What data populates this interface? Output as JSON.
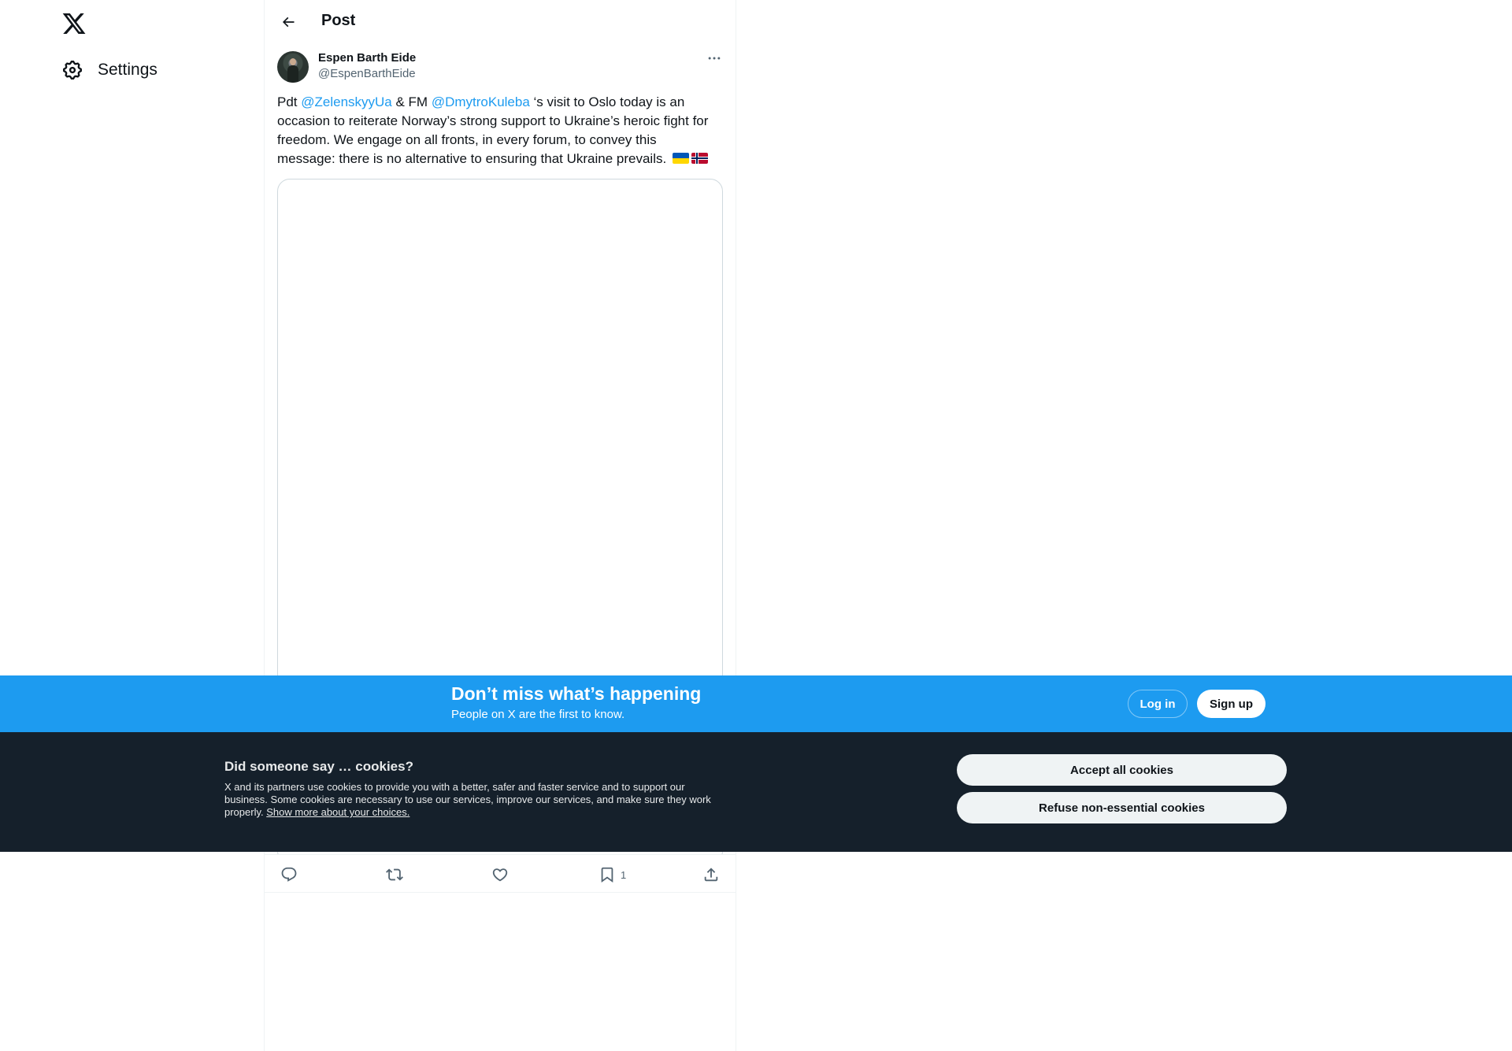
{
  "nav": {
    "logo_icon": "x-logo-icon",
    "settings_label": "Settings"
  },
  "header": {
    "title": "Post"
  },
  "tweet": {
    "author_name": "Espen Barth Eide",
    "author_handle": "@EspenBarthEide",
    "text_segments": {
      "s1": "Pdt ",
      "mention1": "@ZelenskyyUa",
      "s2": " & FM ",
      "mention2": "@DmytroKuleba",
      "s3": " ‘s visit to Oslo today is an occasion to reiterate Norway’s strong support to Ukraine’s heroic fight for freedom. We engage on all fronts, in every forum, to convey this message: there is no alternative to ensuring that Ukraine prevails. "
    },
    "flags": [
      "flag-ukraine",
      "flag-norway"
    ],
    "bookmark_count": "1"
  },
  "banner": {
    "title": "Don’t miss what’s happening",
    "subtitle": "People on X are the first to know.",
    "login_label": "Log in",
    "signup_label": "Sign up",
    "color": "#1d9bf0"
  },
  "cookies": {
    "title": "Did someone say … cookies?",
    "body": "X and its partners use cookies to provide you with a better, safer and faster service and to support our business. Some cookies are necessary to use our services, improve our services, and make sure they work properly. ",
    "link": "Show more about your choices.",
    "accept_label": "Accept all cookies",
    "refuse_label": "Refuse non-essential cookies",
    "background": "#15202b"
  }
}
